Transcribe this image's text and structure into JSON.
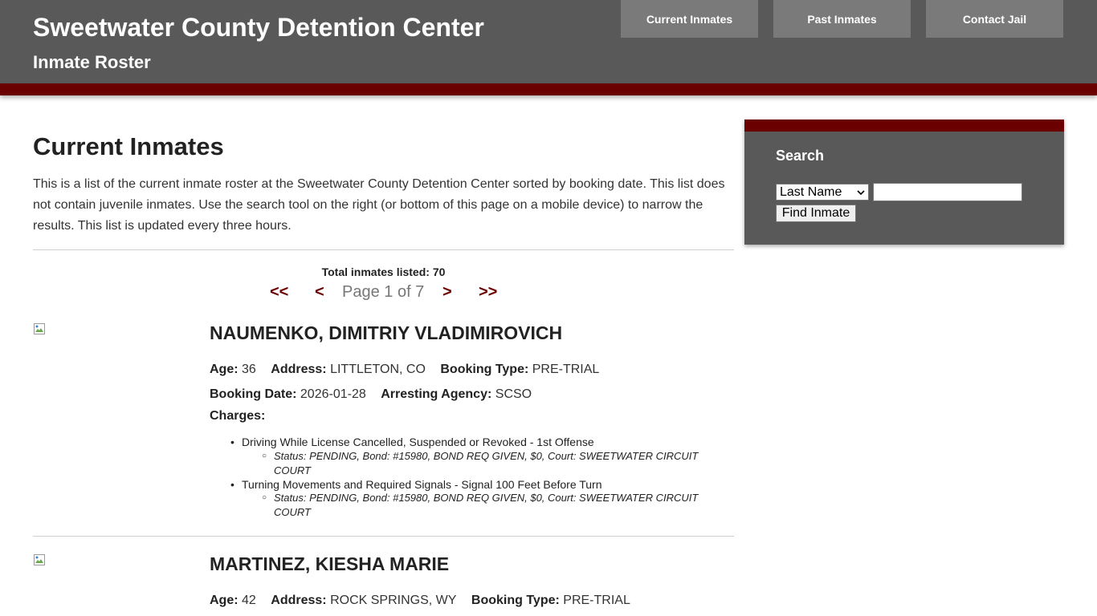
{
  "header": {
    "title": "Sweetwater County Detention Center",
    "subtitle": "Inmate Roster",
    "nav": [
      "Current Inmates",
      "Past Inmates",
      "Contact Jail"
    ]
  },
  "main": {
    "heading": "Current Inmates",
    "intro": "This is a list of the current inmate roster at the Sweetwater County Detention Center sorted by booking date. This list does not contain juvenile inmates. Use the search tool on the right (or bottom of this page on a mobile device) to narrow the results. This list is updated every three hours.",
    "total": "Total inmates listed: 70",
    "pager": {
      "first": "<<",
      "prev": "<",
      "page_text": "Page 1 of 7",
      "next": ">",
      "last": ">>"
    }
  },
  "labels": {
    "age": "Age:",
    "address": "Address:",
    "booking_type": "Booking Type:",
    "booking_date": "Booking Date:",
    "arresting_agency": "Arresting Agency:",
    "charges": "Charges:"
  },
  "inmates": [
    {
      "name": "NAUMENKO, DIMITRIY VLADIMIROVICH",
      "age": "36",
      "address": "LITTLETON, CO",
      "booking_type": "PRE-TRIAL",
      "booking_date": "2026-01-28",
      "arresting_agency": "SCSO",
      "charges": [
        {
          "charge": "Driving While License Cancelled, Suspended or Revoked - 1st Offense",
          "status": "Status: PENDING, Bond: #15980, BOND REQ GIVEN, $0, Court: SWEETWATER CIRCUIT COURT"
        },
        {
          "charge": "Turning Movements and Required Signals - Signal 100 Feet Before Turn",
          "status": "Status: PENDING, Bond: #15980, BOND REQ GIVEN, $0, Court: SWEETWATER CIRCUIT COURT"
        }
      ]
    },
    {
      "name": "MARTINEZ, KIESHA MARIE",
      "age": "42",
      "address": "ROCK SPRINGS, WY",
      "booking_type": "PRE-TRIAL"
    }
  ],
  "search": {
    "title": "Search",
    "select_value": "Last Name",
    "input_value": "",
    "button_label": "Find Inmate"
  },
  "colors": {
    "header_bg": "#595959",
    "accent": "#6b0000",
    "nav_button": "#7a7a7a"
  }
}
